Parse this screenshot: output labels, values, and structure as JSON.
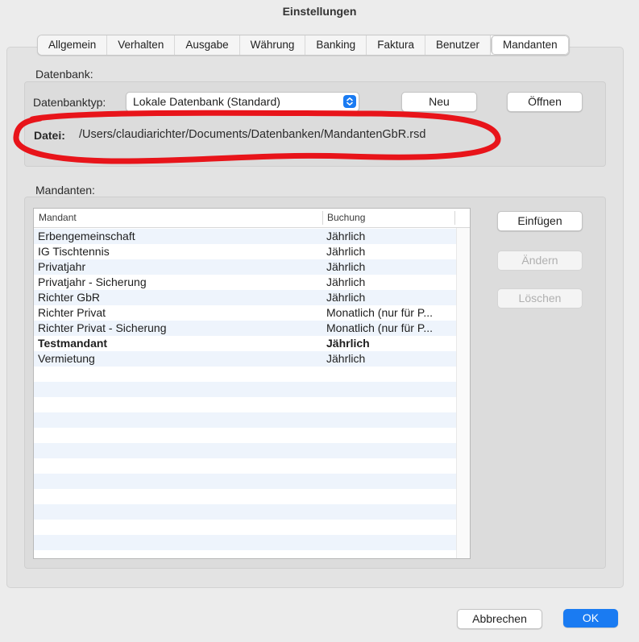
{
  "window": {
    "title": "Einstellungen"
  },
  "tabs": [
    {
      "label": "Allgemein"
    },
    {
      "label": "Verhalten"
    },
    {
      "label": "Ausgabe"
    },
    {
      "label": "Währung"
    },
    {
      "label": "Banking"
    },
    {
      "label": "Faktura"
    },
    {
      "label": "Benutzer"
    },
    {
      "label": "Mandanten",
      "active": true
    }
  ],
  "database": {
    "section_label": "Datenbank:",
    "type_label": "Datenbanktyp:",
    "type_value": "Lokale Datenbank (Standard)",
    "new_button": "Neu",
    "open_button": "Öffnen",
    "file_label": "Datei:",
    "file_path": "/Users/claudiarichter/Documents/Datenbanken/MandantenGbR.rsd"
  },
  "mandanten": {
    "section_label": "Mandanten:",
    "columns": [
      "Mandant",
      "Buchung"
    ],
    "rows": [
      {
        "name": "Erbengemeinschaft",
        "booking": "Jährlich"
      },
      {
        "name": "IG Tischtennis",
        "booking": "Jährlich"
      },
      {
        "name": "Privatjahr",
        "booking": "Jährlich"
      },
      {
        "name": "Privatjahr - Sicherung",
        "booking": "Jährlich"
      },
      {
        "name": "Richter GbR",
        "booking": "Jährlich"
      },
      {
        "name": "Richter Privat",
        "booking": "Monatlich (nur für P..."
      },
      {
        "name": "Richter Privat - Sicherung",
        "booking": "Monatlich (nur für P..."
      },
      {
        "name": "Testmandant",
        "booking": "Jährlich",
        "bold": true
      },
      {
        "name": "Vermietung",
        "booking": "Jährlich"
      }
    ],
    "insert_button": "Einfügen",
    "change_button": "Ändern",
    "delete_button": "Löschen"
  },
  "footer": {
    "cancel_button": "Abbrechen",
    "ok_button": "OK"
  },
  "colors": {
    "accent": "#1a7bf2",
    "annotation": "#e8141a",
    "row_alt": "#eef4fc"
  },
  "icons": {
    "select_arrow": "chevron-updown-icon"
  }
}
